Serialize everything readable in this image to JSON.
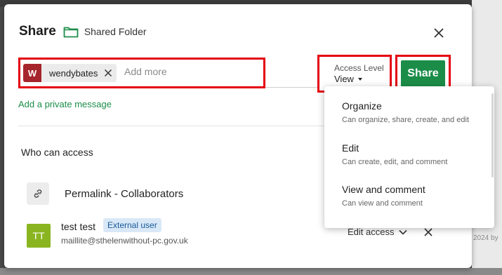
{
  "background": {
    "footer_text": "2024 by"
  },
  "dialog": {
    "title": "Share",
    "folder_name": "Shared Folder",
    "recipient": {
      "avatar_initial": "W",
      "name": "wendybates",
      "placeholder": "Add more"
    },
    "access_level": {
      "label": "Access Level",
      "value": "View"
    },
    "share_label": "Share",
    "private_message_link": "Add a private message",
    "who_can_access_heading": "Who can access",
    "permalink": {
      "label": "Permalink - Collaborators"
    },
    "user": {
      "initials": "TT",
      "name": "test test",
      "badge": "External user",
      "email": "maillite@sthelenwithout-pc.gov.uk",
      "access_label": "Edit access"
    }
  },
  "access_menu": {
    "items": [
      {
        "title": "Organize",
        "description": "Can organize, share, create, and edit"
      },
      {
        "title": "Edit",
        "description": "Can create, edit, and comment"
      },
      {
        "title": "View and comment",
        "description": "Can view and comment"
      }
    ]
  },
  "colors": {
    "accent_green": "#1b8d48",
    "highlight_red": "#e4000f",
    "chip_avatar": "#a6242b",
    "user_avatar": "#8ab520",
    "badge_bg": "#d9e8f7",
    "badge_text": "#17599a"
  },
  "icons": [
    "folder-icon",
    "close-icon",
    "remove-chip-icon",
    "chevron-down-icon",
    "link-icon",
    "remove-user-icon"
  ]
}
